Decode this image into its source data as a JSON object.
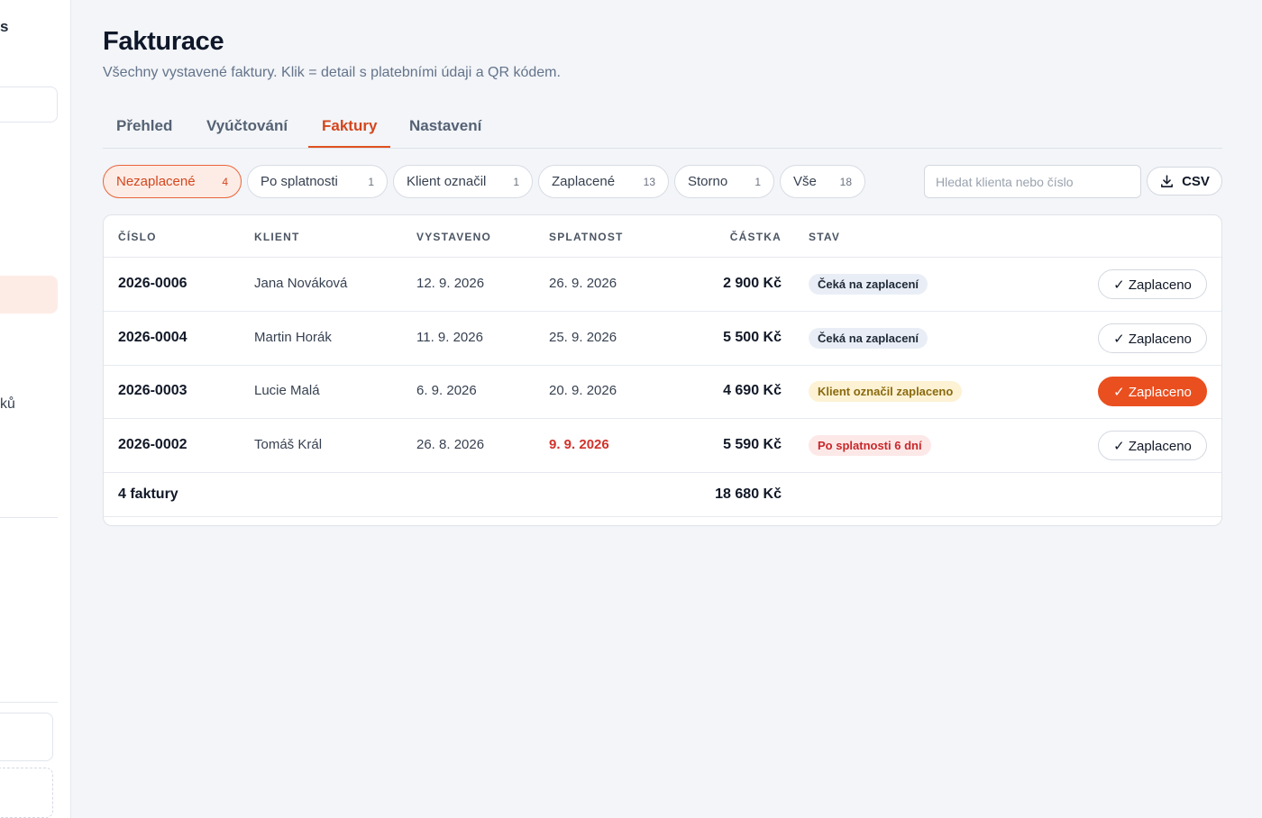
{
  "sidebar": {
    "brand_fragment": "s",
    "label_fragment": "ků"
  },
  "page": {
    "title": "Fakturace",
    "subtitle": "Všechny vystavené faktury. Klik = detail s platebními údaji a QR kódem."
  },
  "tabs": [
    {
      "label": "Přehled",
      "active": false
    },
    {
      "label": "Vyúčtování",
      "active": false
    },
    {
      "label": "Faktury",
      "active": true
    },
    {
      "label": "Nastavení",
      "active": false
    }
  ],
  "filters": [
    {
      "label": "Nezaplacené",
      "count": "4",
      "active": true
    },
    {
      "label": "Po splatnosti",
      "count": "1",
      "active": false
    },
    {
      "label": "Klient označil",
      "count": "1",
      "active": false
    },
    {
      "label": "Zaplacené",
      "count": "13",
      "active": false
    },
    {
      "label": "Storno",
      "count": "1",
      "active": false
    },
    {
      "label": "Vše",
      "count": "18",
      "active": false
    }
  ],
  "search": {
    "placeholder": "Hledat klienta nebo číslo",
    "value": ""
  },
  "csv_button": {
    "label": "CSV",
    "icon": "download-icon"
  },
  "table": {
    "headers": {
      "number": "ČÍSLO",
      "client": "KLIENT",
      "issued": "VYSTAVENO",
      "due": "SPLATNOST",
      "amount": "ČÁSTKA",
      "status": "STAV"
    },
    "rows": [
      {
        "number": "2026-0006",
        "client": "Jana Nováková",
        "issued": "12. 9. 2026",
        "due": "26. 9. 2026",
        "amount": "2 900 Kč",
        "status": "Čeká na zaplacení",
        "action": "✓ Zaplaceno"
      },
      {
        "number": "2026-0004",
        "client": "Martin Horák",
        "issued": "11. 9. 2026",
        "due": "25. 9. 2026",
        "amount": "5 500 Kč",
        "status": "Čeká na zaplacení",
        "action": "✓ Zaplaceno"
      },
      {
        "number": "2026-0003",
        "client": "Lucie Malá",
        "issued": "6. 9. 2026",
        "due": "20. 9. 2026",
        "amount": "4 690 Kč",
        "status": "Klient označil zaplaceno",
        "action": "✓ Zaplaceno"
      },
      {
        "number": "2026-0002",
        "client": "Tomáš Král",
        "issued": "26. 8. 2026",
        "due": "9. 9. 2026",
        "amount": "5 590 Kč",
        "status": "Po splatnosti 6 dní",
        "action": "✓ Zaplaceno"
      }
    ],
    "footer": {
      "count_label": "4 faktury",
      "total": "18 680 Kč"
    }
  },
  "colors": {
    "accent": "#ea4f1f",
    "overdue": "#d1322a",
    "background": "#f3f5f8"
  }
}
